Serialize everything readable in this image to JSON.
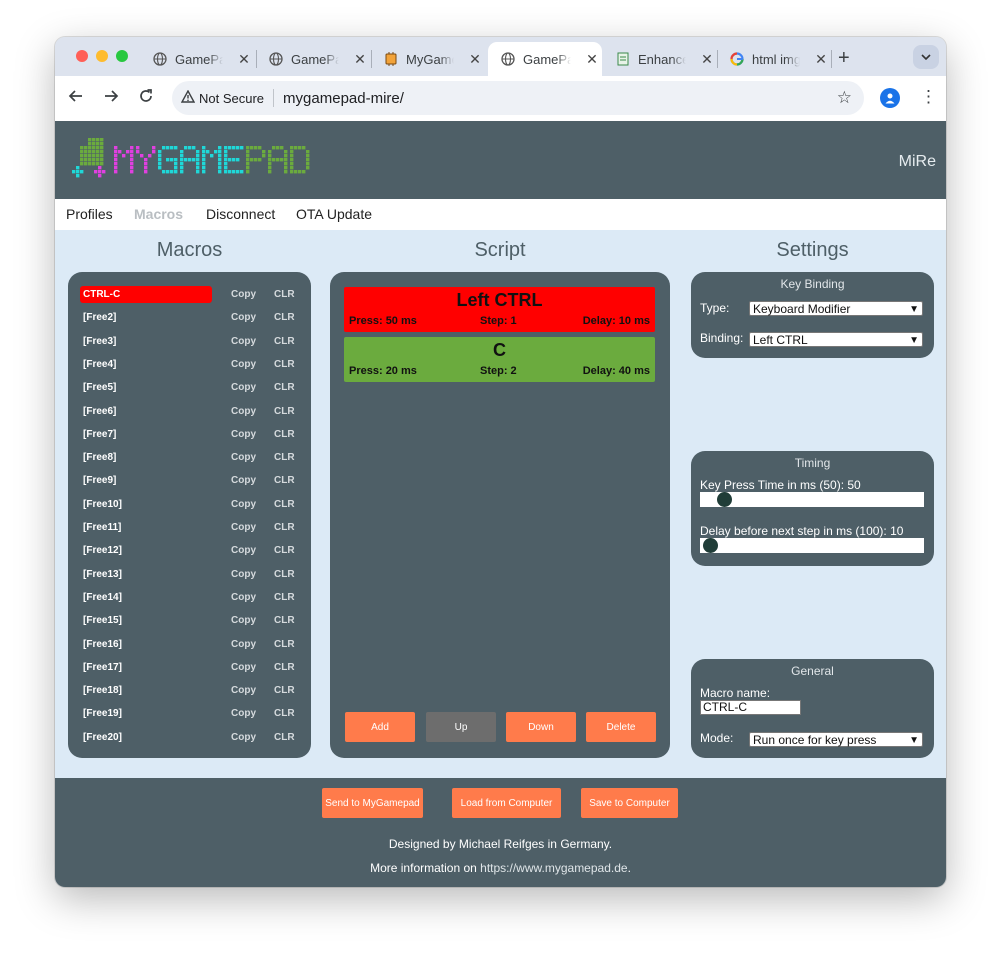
{
  "browser": {
    "tabs": [
      {
        "label": "GamePad",
        "icon": "globe-icon",
        "active": false
      },
      {
        "label": "GamePad",
        "icon": "globe-icon",
        "active": false
      },
      {
        "label": "MyGamePad",
        "icon": "chip-icon",
        "active": false
      },
      {
        "label": "GamePad",
        "icon": "globe-icon",
        "active": true
      },
      {
        "label": "Enhance",
        "icon": "document-icon",
        "active": false
      },
      {
        "label": "html img",
        "icon": "google-icon",
        "active": false
      }
    ],
    "security_label": "Not Secure",
    "url": "mygamepad-mire/"
  },
  "header": {
    "logo_text": "MYGAMEPAD",
    "user": "MiRe"
  },
  "menu": [
    {
      "label": "Profiles",
      "active": false
    },
    {
      "label": "Macros",
      "active": true
    },
    {
      "label": "Disconnect",
      "active": false
    },
    {
      "label": "OTA Update",
      "active": false
    }
  ],
  "sections": {
    "macros": "Macros",
    "script": "Script",
    "settings": "Settings"
  },
  "macros": {
    "copy_label": "Copy",
    "clr_label": "CLR",
    "items": [
      {
        "name": "CTRL-C",
        "selected": true
      },
      {
        "name": "[Free2]"
      },
      {
        "name": "[Free3]"
      },
      {
        "name": "[Free4]"
      },
      {
        "name": "[Free5]"
      },
      {
        "name": "[Free6]"
      },
      {
        "name": "[Free7]"
      },
      {
        "name": "[Free8]"
      },
      {
        "name": "[Free9]"
      },
      {
        "name": "[Free10]"
      },
      {
        "name": "[Free11]"
      },
      {
        "name": "[Free12]"
      },
      {
        "name": "[Free13]"
      },
      {
        "name": "[Free14]"
      },
      {
        "name": "[Free15]"
      },
      {
        "name": "[Free16]"
      },
      {
        "name": "[Free17]"
      },
      {
        "name": "[Free18]"
      },
      {
        "name": "[Free19]"
      },
      {
        "name": "[Free20]"
      }
    ]
  },
  "script": {
    "steps": [
      {
        "key": "Left CTRL",
        "press": "Press: 50 ms",
        "step": "Step: 1",
        "delay": "Delay: 10 ms",
        "color": "#ff0000"
      },
      {
        "key": "C",
        "press": "Press: 20 ms",
        "step": "Step: 2",
        "delay": "Delay: 40 ms",
        "color": "#6bab3e"
      }
    ],
    "buttons": {
      "add": "Add",
      "up": "Up",
      "down": "Down",
      "delete": "Delete"
    }
  },
  "settings": {
    "key_binding": {
      "title": "Key Binding",
      "type_label": "Type:",
      "type_value": "Keyboard Modifier",
      "binding_label": "Binding:",
      "binding_value": "Left CTRL"
    },
    "timing": {
      "title": "Timing",
      "press_label": "Key Press Time in ms (50): 50",
      "press_value": 50,
      "delay_label": "Delay before next step in ms (100): 10",
      "delay_value": 10
    },
    "general": {
      "title": "General",
      "name_label": "Macro name:",
      "name_value": "CTRL-C",
      "mode_label": "Mode:",
      "mode_value": "Run once for key press"
    }
  },
  "footer": {
    "send": "Send to MyGamepad",
    "load": "Load from Computer",
    "save": "Save to Computer",
    "designed": "Designed by Michael Reifges in Germany.",
    "info_prefix": "More information on ",
    "info_link": "https://www.mygamepad.de",
    "info_suffix": "."
  },
  "colors": {
    "header": "#4e5f67",
    "accent_button": "#ff7b4b",
    "selected_macro": "#ff0000",
    "step_one": "#ff0000",
    "step_two": "#6bab3e",
    "logo_green": "#6bab3e",
    "logo_magenta": "#e040e0",
    "logo_cyan": "#1fd8d8"
  }
}
